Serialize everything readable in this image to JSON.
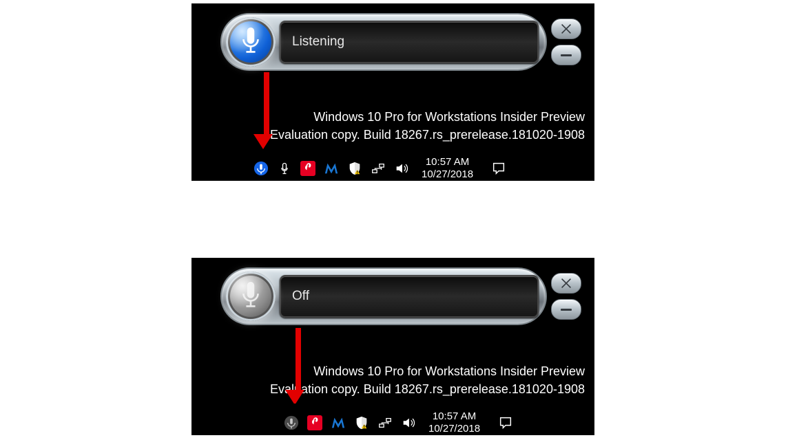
{
  "state_listening": {
    "mic_mode": "listening",
    "status_text": "Listening",
    "arrow_points_to": "tray-speech-icon-active"
  },
  "state_off": {
    "mic_mode": "off",
    "status_text": "Off",
    "arrow_points_to": "tray-speech-icon-inactive"
  },
  "watermark": {
    "line1": "Windows 10 Pro for Workstations Insider Preview",
    "line2": "Evaluation copy. Build 18267.rs_prerelease.181020-1908"
  },
  "tray_listening": {
    "icons": [
      "speech-active",
      "microphone-app",
      "pinterest",
      "malwarebytes",
      "security-warning",
      "network",
      "sound"
    ],
    "time": "10:57 AM",
    "date": "10/27/2018"
  },
  "tray_off": {
    "icons": [
      "speech-inactive",
      "pinterest",
      "malwarebytes",
      "security-warning",
      "network",
      "sound"
    ],
    "time": "10:57 AM",
    "date": "10/27/2018"
  },
  "sr_controls": {
    "close_label": "Close",
    "minimize_label": "Minimize"
  }
}
